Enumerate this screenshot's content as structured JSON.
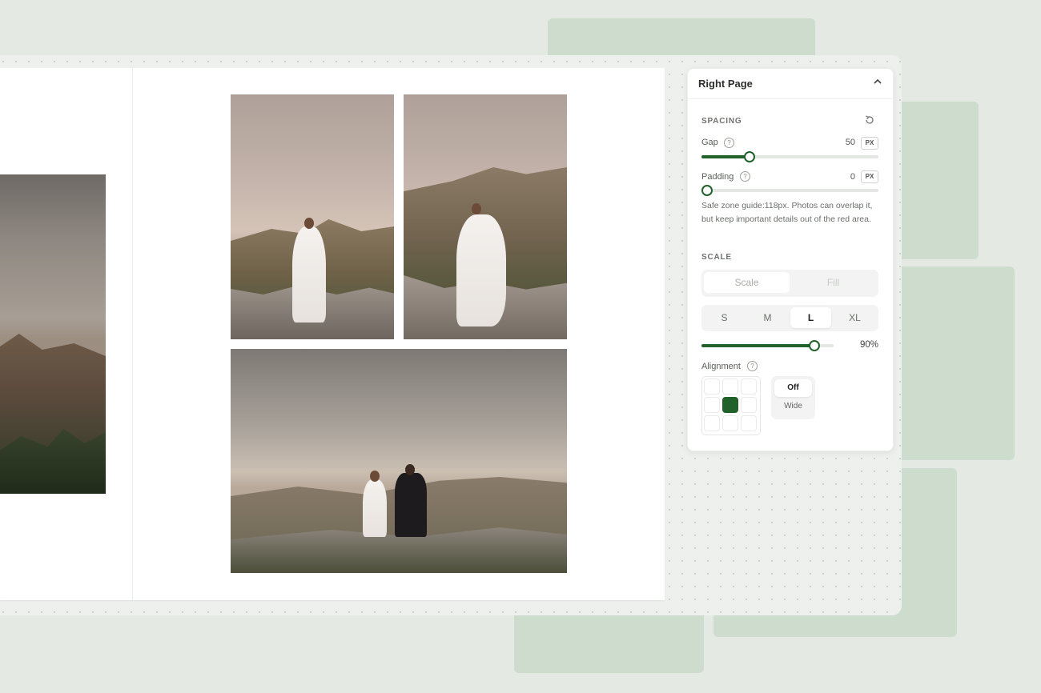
{
  "panel": {
    "title": "Right Page",
    "spacing": {
      "section": "SPACING",
      "gap": {
        "label": "Gap",
        "value": "50",
        "unit": "PX",
        "level": 0.25
      },
      "padding": {
        "label": "Padding",
        "value": "0",
        "unit": "PX",
        "level": 0
      },
      "help_text": "Safe zone guide:118px. Photos can overlap it, but keep important details out of the red area."
    },
    "scale": {
      "section": "SCALE",
      "modes": [
        "Scale",
        "Fill"
      ],
      "sizes": [
        "S",
        "M",
        "L",
        "XL"
      ],
      "selected_size": "L",
      "percent": "90%",
      "level": 0.9
    },
    "alignment": {
      "label": "Alignment",
      "selected_cell": 4,
      "wide_off": "Off",
      "wide_label": "Wide"
    }
  },
  "colors": {
    "accent": "#21612a",
    "background": "#e4e9e4",
    "deco": "#cddccd"
  },
  "icons": [
    "chevron-up-icon",
    "reset-icon",
    "help-icon"
  ]
}
